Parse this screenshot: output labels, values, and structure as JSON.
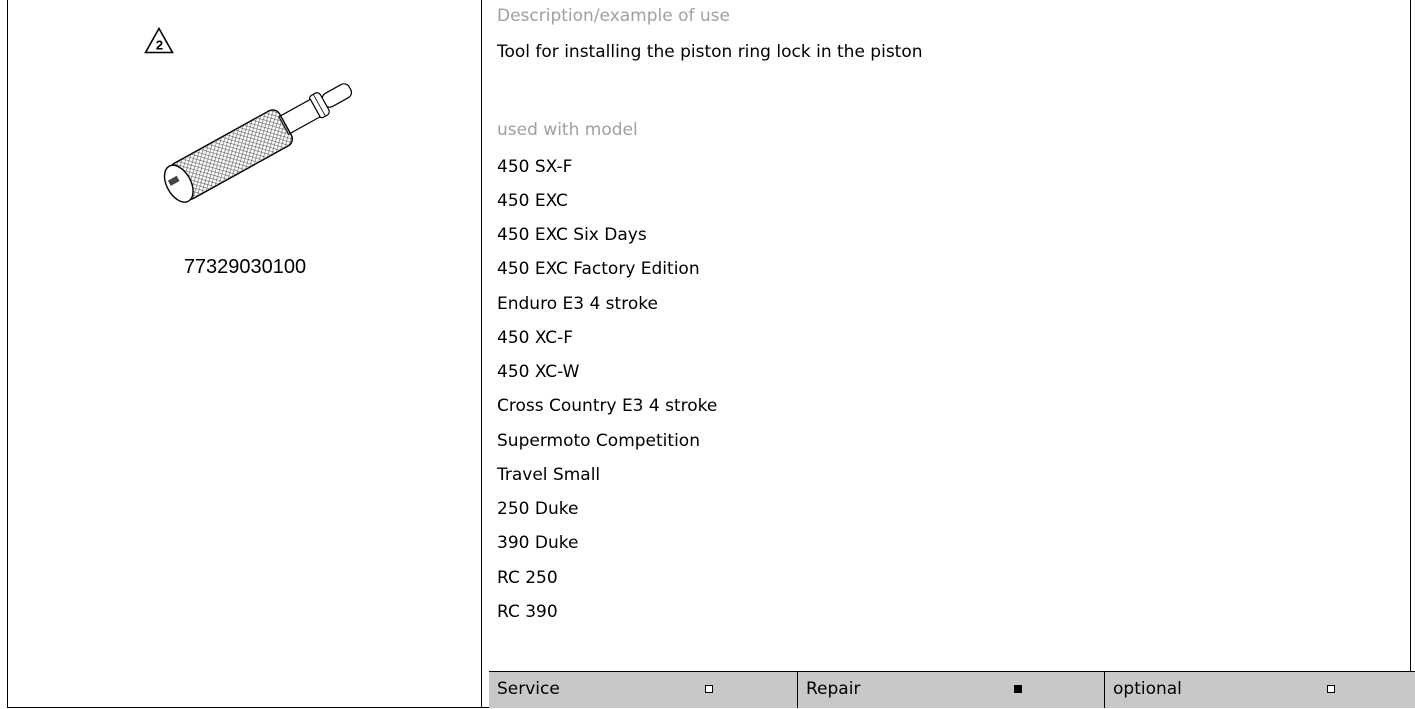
{
  "part_number": "77329030100",
  "warning_number": "2",
  "description_label": "Description/example of use",
  "description_text": "Tool for installing the piston ring lock in the piston",
  "models_label": "used with model",
  "models": [
    "450 SX-F",
    "450 EXC",
    "450 EXC Six Days",
    "450 EXC Factory Edition",
    "Enduro E3 4 stroke",
    "450 XC-F",
    "450 XC-W",
    "Cross Country E3 4 stroke",
    "Supermoto Competition",
    "Travel Small",
    "250 Duke",
    "390 Duke",
    "RC 250",
    "RC 390"
  ],
  "categories": [
    {
      "label": "Service",
      "checked": false
    },
    {
      "label": "Repair",
      "checked": true
    },
    {
      "label": "optional",
      "checked": false
    }
  ]
}
